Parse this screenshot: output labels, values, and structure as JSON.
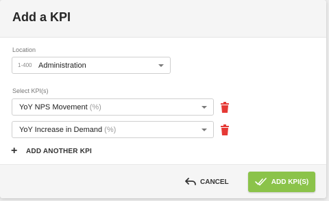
{
  "dialog": {
    "title": "Add a KPI"
  },
  "location": {
    "label": "Location",
    "code": "1-400",
    "value": "Administration"
  },
  "kpis": {
    "label": "Select KPI(s)",
    "items": [
      {
        "name": "YoY NPS Movement",
        "unit": "(%)"
      },
      {
        "name": "YoY Increase in Demand",
        "unit": "(%)"
      }
    ],
    "add_another_label": "ADD ANOTHER KPI"
  },
  "footer": {
    "cancel_label": "CANCEL",
    "add_label": "ADD KPI(S)"
  },
  "colors": {
    "accent": "#8bc34a",
    "delete": "#e53935"
  },
  "icons": {
    "delete": "trash-icon",
    "add": "plus-icon",
    "cancel": "undo-icon",
    "confirm": "double-check-icon",
    "dropdown": "caret-down-icon"
  }
}
